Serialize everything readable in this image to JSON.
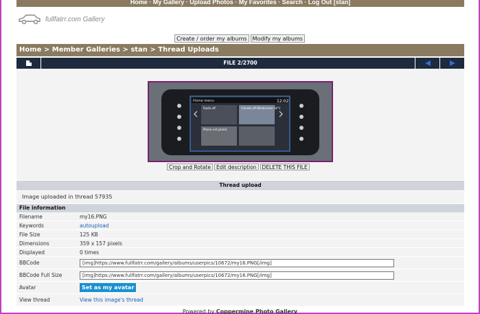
{
  "top_nav": {
    "items": [
      "Home",
      "My Gallery",
      "Upload Photos",
      "My Favorites",
      "Search",
      "Log Out [stan]"
    ],
    "text": "Home · My Gallery · Upload Photos · My Favorites · Search · Log Out [stan]"
  },
  "site": {
    "logo_text": "fullfatrr.com Gallery"
  },
  "album_buttons": {
    "create": "Create / order my albums",
    "modify": "Modify my albums"
  },
  "breadcrumb": "Home > Member Galleries > stan > Thread Uploads",
  "file_nav": {
    "counter": "FILE 2/2700"
  },
  "photo": {
    "screen_time": "12:02",
    "screen_header": "Home menu",
    "tile1": "Radio off",
    "tile2": "Climate off Windscreen 18°C",
    "tile3": "Phone not paired",
    "tile4": ""
  },
  "photo_actions": {
    "crop": "Crop and Rotate",
    "edit": "Edit description",
    "delete": "DELETE THIS FILE"
  },
  "section": {
    "title": "Thread upload",
    "description": "Image uploaded in thread 57935"
  },
  "file_info": {
    "heading": "File information",
    "rows": [
      {
        "key": "Filename",
        "value": "my16.PNG"
      },
      {
        "key": "Keywords",
        "value": "autoupload"
      },
      {
        "key": "File Size",
        "value": "125 KB"
      },
      {
        "key": "Dimensions",
        "value": "359 x 157 pixels"
      },
      {
        "key": "Displayed",
        "value": "0 times"
      },
      {
        "key": "BBCode",
        "value": "[img]https://www.fullfatrr.com/gallery/albums/userpics/10672/my16.PNG[/img]"
      },
      {
        "key": "BBCode Full Size",
        "value": "[img]https://www.fullfatrr.com/gallery/albums/userpics/10672/my16.PNG[/img]"
      },
      {
        "key": "Avatar",
        "value": "Set as my avatar"
      },
      {
        "key": "View thread",
        "value": "View this image's thread"
      }
    ]
  },
  "footer": {
    "prefix": "Powered by",
    "name": "Coppermine Photo Gallery"
  },
  "colors": {
    "header_brown": "#8a7a60",
    "nav_dark": "#1e2b3e",
    "accent_blue": "#1790d0",
    "link_blue": "#1a5fb4"
  }
}
